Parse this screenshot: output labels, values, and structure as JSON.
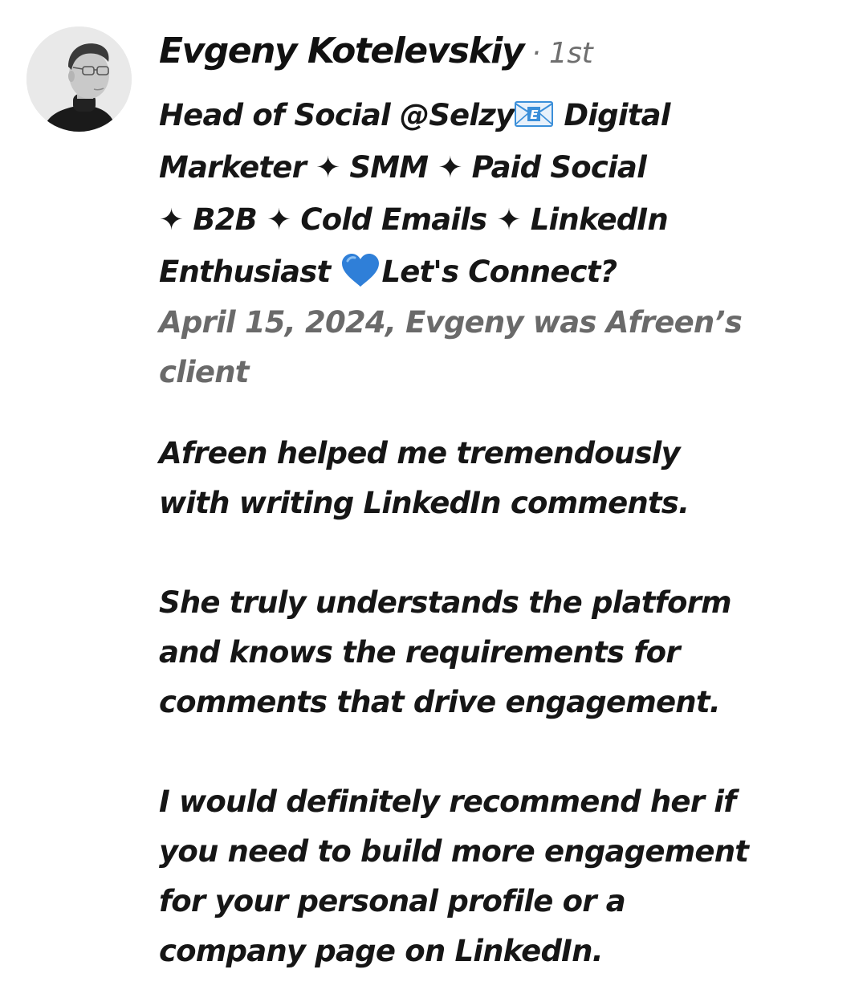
{
  "recommendation": {
    "author": {
      "name": "Evgeny Kotelevskiy",
      "degree": "· 1st",
      "headline_lines": [
        [
          "Head of Social @Selzy",
          "mail-icon",
          " Digital"
        ],
        [
          "Marketer ✦ SMM ✦ Paid Social"
        ],
        [
          "✦ B2B ✦ Cold Emails ✦ LinkedIn"
        ],
        [
          "Enthusiast ",
          "blue-heart-icon",
          "Let's Connect?"
        ]
      ],
      "headline": {
        "l1_a": "Head of Social @Selzy",
        "l1_b": " Digital",
        "l2": "Marketer ✦ SMM ✦ Paid Social",
        "l3": "✦ B2B ✦ Cold Emails ✦ LinkedIn",
        "l4_a": "Enthusiast ",
        "l4_b": "Let's Connect?"
      }
    },
    "relationship": {
      "line1": "April 15, 2024, Evgeny was Afreen’s",
      "line2": "client"
    },
    "body": {
      "p1": [
        "Afreen helped me tremendously",
        "with writing LinkedIn comments."
      ],
      "p2": [
        "She truly understands the platform",
        "and knows the requirements for",
        "comments that drive engagement."
      ],
      "p3": [
        "I would definitely recommend her if",
        "you need to build more engagement",
        "for your personal profile or a",
        "company page on LinkedIn."
      ]
    },
    "colors": {
      "text": "#161616",
      "meta": "#6a6a6a",
      "heart": "#2f7fd8",
      "mail": "#3b8fd9"
    }
  }
}
